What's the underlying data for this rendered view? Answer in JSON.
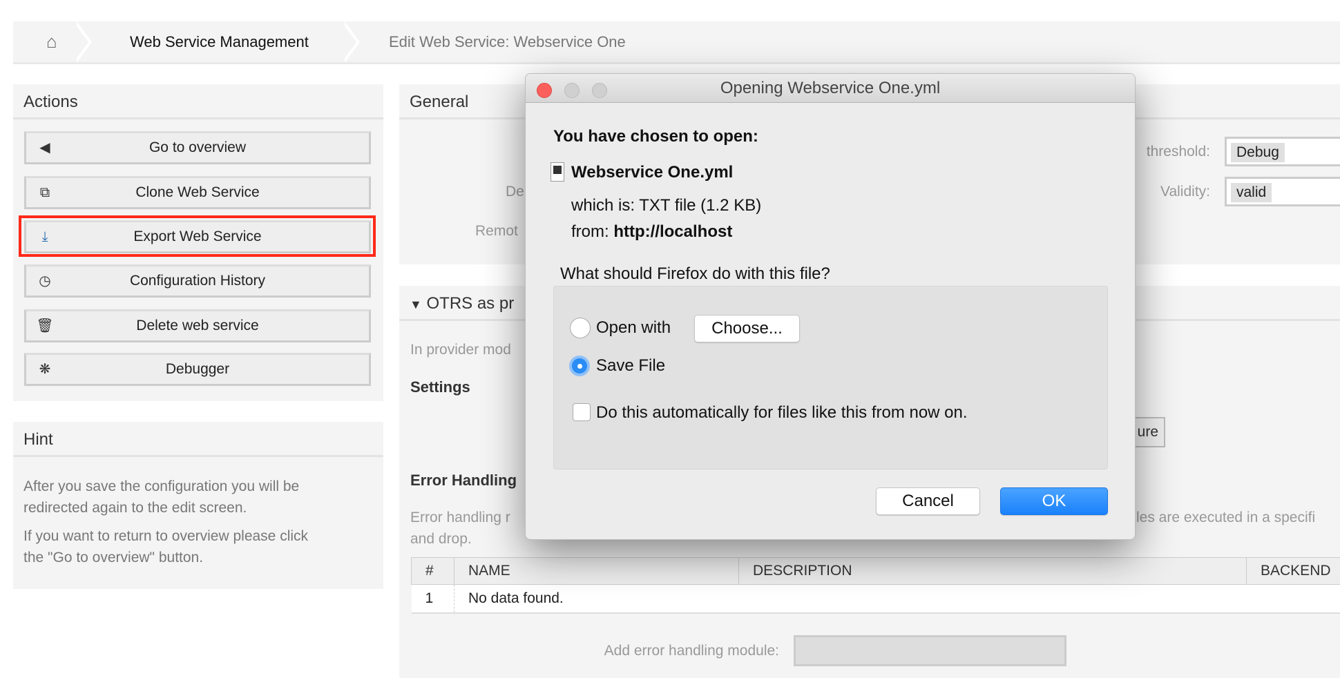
{
  "breadcrumb": {
    "home_icon": "home-icon",
    "items": [
      "Web Service Management",
      "Edit Web Service: Webservice One"
    ]
  },
  "actions": {
    "title": "Actions",
    "buttons": [
      {
        "label": "Go to overview",
        "icon": "caret-left-icon"
      },
      {
        "label": "Clone Web Service",
        "icon": "clone-icon"
      },
      {
        "label": "Export Web Service",
        "icon": "download-icon"
      },
      {
        "label": "Configuration History",
        "icon": "clock-icon"
      },
      {
        "label": "Delete web service",
        "icon": "trash-icon"
      },
      {
        "label": "Debugger",
        "icon": "bug-icon"
      }
    ],
    "highlight_color": "#ff2a1a"
  },
  "hint": {
    "title": "Hint",
    "lines": [
      "After you save the configuration you will be",
      "redirected again to the edit screen.",
      "If you want to return to overview please click",
      "the \"Go to overview\" button."
    ]
  },
  "general": {
    "title": "General",
    "label_de": "De",
    "label_remote": "Remot",
    "threshold_label": "threshold:",
    "threshold_value": "Debug",
    "validity_label": "Validity:",
    "validity_value": "valid"
  },
  "provider": {
    "title": "OTRS as pr",
    "intro": "In provider mod",
    "settings": "Settings",
    "configure_btn": "ure",
    "error_handling": "Error Handling",
    "error_text_1": "Error handling r",
    "error_text_right": "les are executed in a specifi",
    "error_text_2": "and drop.",
    "table": {
      "headers": [
        "#",
        "NAME",
        "DESCRIPTION",
        "BACKEND"
      ],
      "rows": [
        [
          "1",
          "No data found."
        ]
      ]
    },
    "add_module_label": "Add error handling module:"
  },
  "dialog": {
    "title": "Opening Webservice One.yml",
    "heading": "You have chosen to open:",
    "filename": "Webservice One.yml",
    "which_is_label": "which is:",
    "which_is_value": "TXT file (1.2 KB)",
    "from_label": "from:",
    "from_value": "http://localhost",
    "question": "What should Firefox do with this file?",
    "open_with": "Open with",
    "choose": "Choose...",
    "save_file": "Save File",
    "selected": "Save File",
    "auto": "Do this automatically for files like this from now on.",
    "auto_checked": false,
    "cancel": "Cancel",
    "ok": "OK",
    "ok_color": "#1a82fb"
  }
}
